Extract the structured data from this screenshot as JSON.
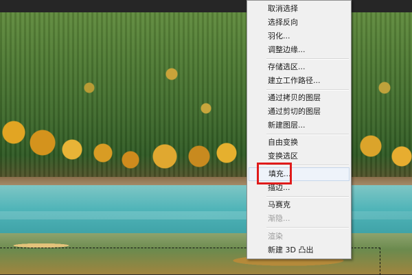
{
  "context_menu": {
    "items": [
      {
        "label": "取消选择",
        "enabled": true
      },
      {
        "label": "选择反向",
        "enabled": true
      },
      {
        "label": "羽化...",
        "enabled": true
      },
      {
        "label": "调整边缘...",
        "enabled": true
      },
      {
        "label": "存储选区...",
        "enabled": true
      },
      {
        "label": "建立工作路径...",
        "enabled": true
      },
      {
        "label": "通过拷贝的图层",
        "enabled": true
      },
      {
        "label": "通过剪切的图层",
        "enabled": true
      },
      {
        "label": "新建图层...",
        "enabled": true
      },
      {
        "label": "自由变换",
        "enabled": true
      },
      {
        "label": "变换选区",
        "enabled": true
      },
      {
        "label": "填充...",
        "enabled": true,
        "highlighted": true
      },
      {
        "label": "描边...",
        "enabled": true
      },
      {
        "label": "马赛克",
        "enabled": true
      },
      {
        "label": "渐隐...",
        "enabled": false
      },
      {
        "label": "渲染",
        "enabled": false
      },
      {
        "label": "新建 3D 凸出",
        "enabled": true
      }
    ]
  },
  "annotation": {
    "color": "#e01b1b",
    "target": "填充..."
  }
}
